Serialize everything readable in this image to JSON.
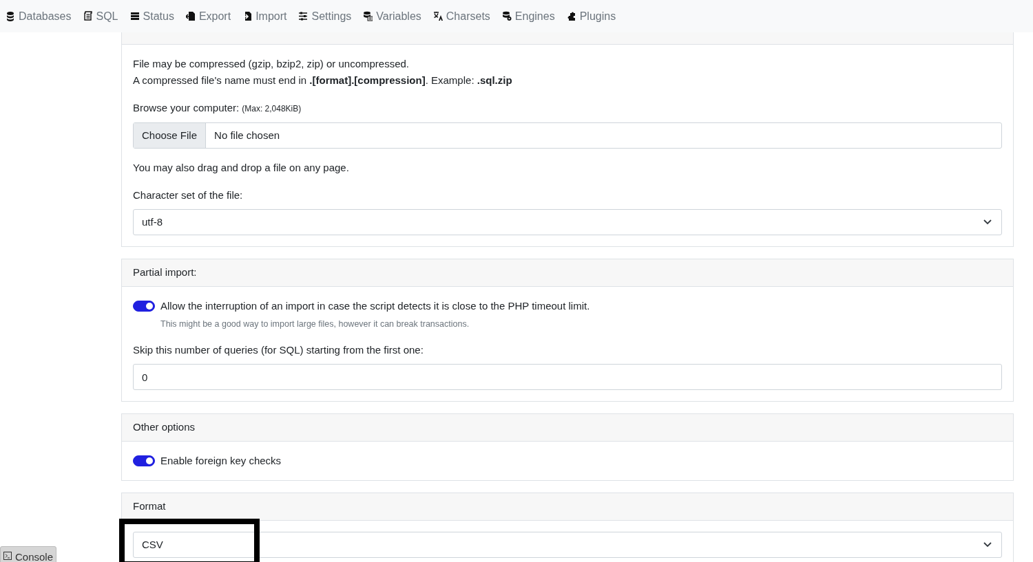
{
  "nav": [
    {
      "label": "Databases"
    },
    {
      "label": "SQL"
    },
    {
      "label": "Status"
    },
    {
      "label": "Export"
    },
    {
      "label": "Import"
    },
    {
      "label": "Settings"
    },
    {
      "label": "Variables"
    },
    {
      "label": "Charsets"
    },
    {
      "label": "Engines"
    },
    {
      "label": "Plugins"
    }
  ],
  "import_file": {
    "help": [
      "File may be compressed (gzip, bzip2, zip) or uncompressed.",
      "A compressed file's name must end in **.[format].[compression]**. Example: **.sql.zip**"
    ],
    "browse_label": "Browse your computer:",
    "max_note": "(Max: 2,048KiB)",
    "file_button": "Choose File",
    "file_status": "No file chosen",
    "drag_note": "You may also drag and drop a file on any page.",
    "charset_label": "Character set of the file:",
    "charset_value": "utf-8"
  },
  "partial_import": {
    "title": "Partial import:",
    "interrupt": {
      "label": "Allow the interruption of an import in case the script detects it is close to the PHP timeout limit.",
      "on": true,
      "hint": "This might be a good way to import large files, however it can break transactions."
    },
    "skip_label": "Skip this number of queries (for SQL) starting from the first one:",
    "skip_value": "0"
  },
  "other_options": {
    "title": "Other options",
    "foreign_key_checks": {
      "label": "Enable foreign key checks",
      "on": true
    }
  },
  "format": {
    "title": "Format",
    "value": "CSV",
    "highlighted": true
  },
  "console": {
    "label": "Console"
  }
}
